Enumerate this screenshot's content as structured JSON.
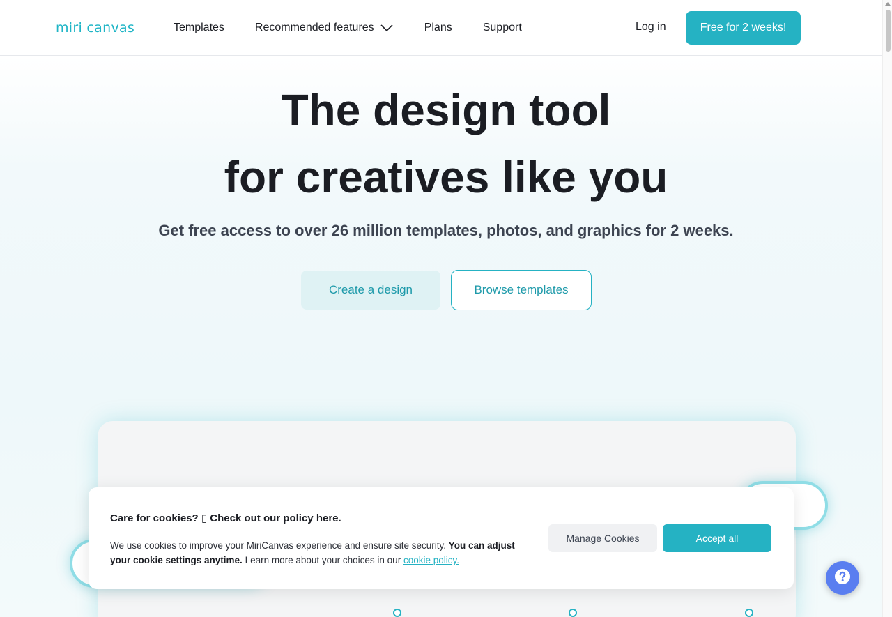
{
  "header": {
    "logo_text": "miri canvas",
    "nav": [
      {
        "label": "Templates"
      },
      {
        "label": "Recommended features",
        "has_dropdown": true
      },
      {
        "label": "Plans"
      },
      {
        "label": "Support"
      }
    ],
    "login_label": "Log in",
    "cta_label": "Free for 2 weeks!"
  },
  "hero": {
    "title_line1": "The design tool",
    "title_line2": "for creatives like you",
    "subtitle": "Get free access to over 26 million templates, photos, and graphics for 2 weeks.",
    "create_label": "Create a design",
    "browse_label": "Browse templates"
  },
  "cookie": {
    "title": "Care for cookies? ▯ Check out our policy here.",
    "text_plain1": "We use cookies to improve your MiriCanvas experience and ensure site security. ",
    "text_bold": "You can adjust your cookie settings anytime.",
    "text_plain2": " Learn more about your choices in our ",
    "link_label": "cookie policy.",
    "manage_label": "Manage Cookies",
    "accept_label": "Accept all"
  },
  "help": {
    "icon": "question-icon"
  },
  "colors": {
    "brand": "#25b2c3",
    "text": "#1b1d23",
    "help_button": "#5a7ef0"
  }
}
